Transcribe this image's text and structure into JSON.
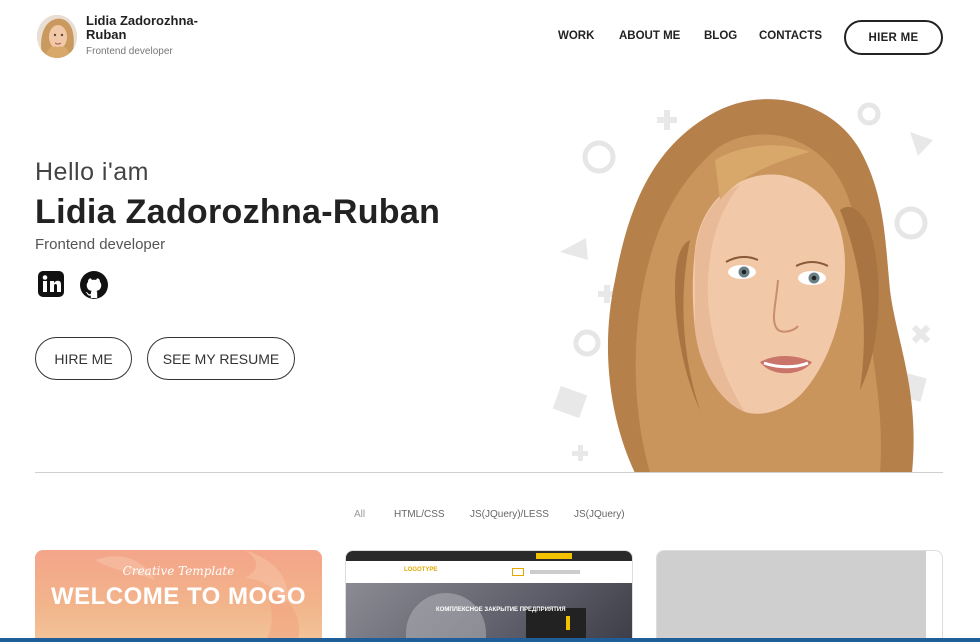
{
  "header": {
    "name": "Lidia Zadorozhna-Ruban",
    "subtitle": "Frontend developer",
    "nav": [
      "WORK",
      "ABOUT ME",
      "BLOG",
      "CONTACTS"
    ],
    "hire_button": "HIER ME"
  },
  "hero": {
    "greeting": "Hello i'am",
    "name": "Lidia Zadorozhna-Ruban",
    "role": "Frontend developer",
    "social_icons": [
      "linkedin-icon",
      "github-icon"
    ],
    "hire_button": "HIRE ME",
    "resume_button": "SEE MY RESUME"
  },
  "filters": {
    "items": [
      "All",
      "HTML/CSS",
      "JS(JQuery)/LESS",
      "JS(JQuery)"
    ],
    "active": "All"
  },
  "cards": {
    "card1": {
      "kicker": "Creative Template",
      "title": "WELCOME TO MOGO"
    },
    "card2": {
      "banner": "КОМПЛЕКСНОЕ ЗАКРЫТИЕ ПРЕДПРИЯТИЯ",
      "logo": "LOGOTYPE"
    }
  },
  "colors": {
    "text": "#222222",
    "accent_card": "#f4a58a",
    "divider": "#cfcfcf"
  }
}
